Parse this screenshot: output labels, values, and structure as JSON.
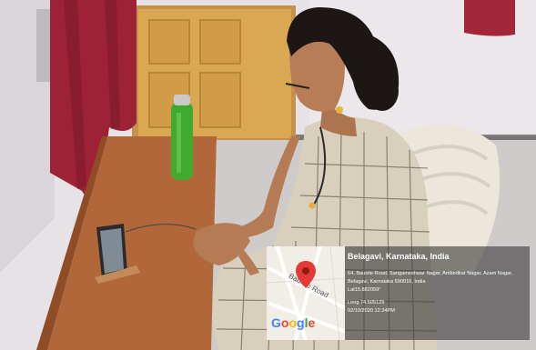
{
  "photo": {
    "colors": {
      "wall": "#e8e4e6",
      "door": "#d8a24a",
      "curtain": "#a3273a",
      "desk": "#b5683a",
      "chair": "#ece8dc",
      "floor": "#cfcccb",
      "bottle": "#3fae2e"
    }
  },
  "geotag": {
    "map_road_label": "Bauxite Road",
    "map_logo": "Google",
    "title": "Belagavi, Karnataka, India",
    "address_line1": "64, Bauxite Road, Sangameshwar Nagar, Ambedkar Nagar, Azam Nagar,",
    "address_line2": "Belagavi, Karnataka 590010, India",
    "lat": "Lat15.882059°",
    "long": "Long 74.505129",
    "timestamp": "02/10/2020 12:24PM"
  }
}
